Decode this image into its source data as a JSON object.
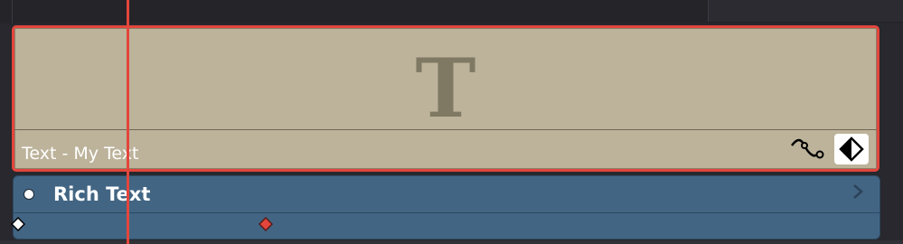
{
  "timeline": {
    "text_clip": {
      "glyph": "T",
      "label": "Text - My Text",
      "curve_icon": "curve-icon",
      "keyframe_icon": "keyframe-diamond-icon",
      "colors": {
        "fill": "#bdb39b",
        "selected_border": "#e3463c",
        "glyph": "#7f7963"
      }
    },
    "rich_text_track": {
      "label": "Rich Text",
      "expand_icon": "chevron-right-icon",
      "keyframe_colors": [
        "#ffffff",
        "#e3463c"
      ],
      "fill": "#426583"
    },
    "playhead_color": "#e3463c"
  }
}
